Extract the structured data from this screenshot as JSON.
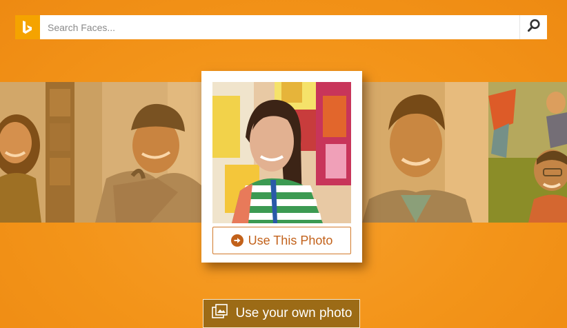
{
  "search": {
    "placeholder": "Search Faces..."
  },
  "featured": {
    "button_label": "Use This Photo"
  },
  "own_photo": {
    "button_label": "Use your own photo"
  },
  "icons": {
    "logo": "bing-logo-icon",
    "search": "search-icon",
    "use_photo": "arrow-circle-right-icon",
    "own_photo": "photos-stack-icon"
  },
  "colors": {
    "background": "#f39419",
    "logo": "#f5a300",
    "accent_text": "#c2611a",
    "own_photo_button": "#9c6b16"
  }
}
